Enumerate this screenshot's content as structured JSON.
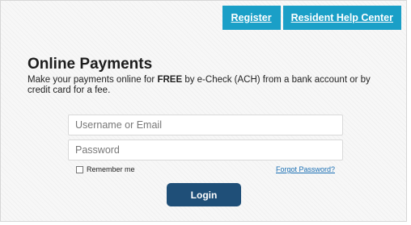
{
  "header": {
    "register_label": "Register",
    "help_center_label": "Resident Help Center"
  },
  "payments": {
    "title": "Online Payments",
    "desc_prefix": "Make your payments online for ",
    "desc_emphasis": "FREE",
    "desc_suffix": " by e-Check (ACH) from a bank account or by credit card for a fee."
  },
  "form": {
    "username_placeholder": "Username or Email",
    "password_placeholder": "Password",
    "remember_label": "Remember me",
    "remember_checked": false,
    "forgot_label": "Forgot Password?",
    "login_label": "Login"
  },
  "colors": {
    "accent": "#1a9fc7",
    "login_button": "#1f4f78",
    "link": "#1a6fb4"
  }
}
